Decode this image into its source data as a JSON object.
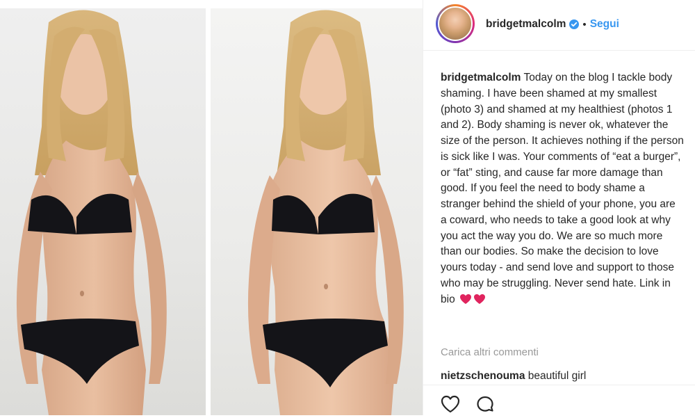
{
  "post": {
    "username": "bridgetmalcolm",
    "separator": "•",
    "follow_label": "Segui",
    "verified": true
  },
  "caption": {
    "username": "bridgetmalcolm",
    "text": "Today on the blog I tackle body shaming. I have been shamed at my smallest (photo 3) and shamed at my healthiest (photos 1 and 2). Body shaming is never ok, whatever the size of the person. It achieves nothing if the person is sick like I was. Your comments of “eat a burger”, or “fat” sting, and cause far more damage than good. If you feel the need to body shame a stranger behind the shield of your phone, you are a coward, who needs to take a good look at why you act the way you do. We are so much more than our bodies. So make the decision to love yours today - and send love and support to those who may be struggling. Never send hate. Link in bio",
    "emoji": [
      "red-heart",
      "red-heart"
    ]
  },
  "comments": {
    "load_more_label": "Carica altri commenti",
    "items": [
      {
        "username": "nietzschenouma",
        "text": "beautiful girl"
      }
    ]
  },
  "actions": {
    "icons": [
      "heart-icon",
      "comment-icon"
    ]
  },
  "colors": {
    "link_blue": "#3897f0",
    "text": "#262626",
    "muted": "#999999",
    "heart_red": "#e0245e"
  },
  "media": {
    "panels": [
      "photo-panel-1",
      "photo-panel-2"
    ]
  }
}
